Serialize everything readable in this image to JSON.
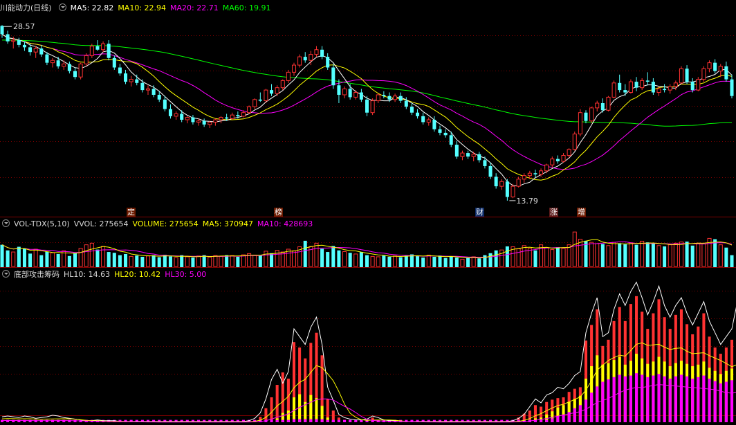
{
  "price_panel": {
    "stock_name": "川能动力",
    "period": "(日线)",
    "ma5_label": "MA5: 22.82",
    "ma10_label": "MA10: 22.94",
    "ma20_label": "MA20: 22.71",
    "ma60_label": "MA60: 19.91",
    "high_marker": "28.57",
    "low_marker": "13.79"
  },
  "event_tags": [
    "定",
    "榜",
    "财",
    "涨",
    "增"
  ],
  "volume_panel": {
    "name": "VOL-TDX(5,10)",
    "vvol_label": "VVOL: 275654",
    "volume_label": "VOLUME: 275654",
    "ma5_label": "MA5: 370947",
    "ma10_label": "MA10: 428693"
  },
  "indicator_panel": {
    "name": "底部攻击筹码",
    "hl10_label": "HL10: 14.63",
    "hl20_label": "HL20: 10.42",
    "hl30_label": "HL30: 5.00"
  },
  "colors": {
    "up": "#ff3232",
    "down": "#54ffff",
    "ma5": "#ffffff",
    "ma10": "#ffff00",
    "ma20": "#ff00ff",
    "ma60": "#00ff00",
    "grid": "#800000"
  },
  "chart_data": {
    "type": "candlestick",
    "price_markers": {
      "high": 28.57,
      "low": 13.79
    },
    "moving_average_values": {
      "MA5": 22.82,
      "MA10": 22.94,
      "MA20": 22.71,
      "MA60": 19.91
    },
    "volume_indicator_values": {
      "VVOL": 275654,
      "VOLUME": 275654,
      "MA5": 370947,
      "MA10": 428693
    },
    "bottom_indicator_values": {
      "HL10": 14.63,
      "HL20": 10.42,
      "HL30": 5.0
    },
    "ohlc": [
      [
        28.5,
        28.57,
        27.5,
        27.8
      ],
      [
        27.8,
        28.1,
        27.0,
        27.2
      ],
      [
        27.2,
        27.6,
        26.6,
        27.3
      ],
      [
        27.3,
        27.5,
        26.7,
        26.9
      ],
      [
        26.9,
        27.2,
        26.4,
        26.7
      ],
      [
        26.7,
        27.0,
        26.0,
        26.3
      ],
      [
        26.3,
        26.8,
        25.8,
        26.6
      ],
      [
        26.6,
        26.9,
        25.9,
        26.1
      ],
      [
        26.1,
        26.3,
        25.2,
        25.4
      ],
      [
        25.4,
        25.8,
        25.0,
        25.6
      ],
      [
        25.6,
        25.9,
        24.9,
        25.1
      ],
      [
        25.1,
        25.6,
        24.8,
        25.3
      ],
      [
        25.3,
        25.5,
        24.5,
        24.7
      ],
      [
        24.7,
        25.0,
        24.0,
        24.2
      ],
      [
        24.2,
        25.4,
        24.0,
        25.3
      ],
      [
        25.3,
        26.2,
        25.1,
        26.0
      ],
      [
        26.0,
        27.0,
        25.8,
        26.8
      ],
      [
        26.8,
        27.3,
        26.4,
        26.5
      ],
      [
        26.5,
        27.2,
        26.3,
        27.0
      ],
      [
        27.0,
        27.3,
        25.6,
        25.8
      ],
      [
        25.8,
        26.0,
        24.8,
        25.0
      ],
      [
        25.0,
        25.3,
        24.3,
        24.5
      ],
      [
        24.5,
        24.8,
        23.6,
        23.8
      ],
      [
        23.8,
        24.3,
        23.4,
        24.0
      ],
      [
        24.0,
        24.4,
        23.5,
        23.7
      ],
      [
        23.7,
        24.0,
        22.9,
        23.1
      ],
      [
        23.1,
        23.5,
        22.7,
        23.2
      ],
      [
        23.2,
        23.5,
        22.5,
        22.7
      ],
      [
        22.7,
        23.0,
        22.1,
        22.3
      ],
      [
        22.3,
        22.6,
        21.3,
        21.5
      ],
      [
        21.5,
        21.9,
        20.7,
        20.9
      ],
      [
        20.9,
        21.3,
        20.6,
        21.1
      ],
      [
        21.1,
        21.4,
        20.4,
        20.6
      ],
      [
        20.6,
        20.9,
        20.3,
        20.8
      ],
      [
        20.8,
        21.0,
        20.2,
        20.4
      ],
      [
        20.4,
        20.7,
        20.1,
        20.5
      ],
      [
        20.5,
        20.7,
        20.0,
        20.2
      ],
      [
        20.2,
        20.5,
        19.9,
        20.4
      ],
      [
        20.4,
        20.7,
        20.1,
        20.6
      ],
      [
        20.6,
        20.9,
        20.3,
        20.8
      ],
      [
        20.8,
        21.1,
        20.5,
        20.7
      ],
      [
        20.7,
        21.2,
        20.6,
        21.0
      ],
      [
        21.0,
        21.3,
        20.7,
        20.9
      ],
      [
        20.9,
        21.4,
        20.8,
        21.2
      ],
      [
        21.2,
        21.8,
        21.1,
        21.7
      ],
      [
        21.7,
        22.4,
        21.5,
        22.3
      ],
      [
        22.3,
        22.9,
        22.1,
        22.2
      ],
      [
        22.2,
        23.2,
        22.0,
        23.1
      ],
      [
        23.1,
        23.6,
        22.6,
        22.8
      ],
      [
        22.8,
        23.5,
        22.6,
        23.3
      ],
      [
        23.3,
        24.0,
        23.1,
        23.9
      ],
      [
        23.9,
        24.8,
        23.7,
        24.6
      ],
      [
        24.6,
        25.4,
        24.3,
        25.2
      ],
      [
        25.2,
        26.1,
        25.0,
        25.9
      ],
      [
        25.9,
        26.3,
        25.4,
        25.6
      ],
      [
        25.6,
        26.4,
        25.2,
        26.1
      ],
      [
        26.1,
        26.8,
        25.9,
        26.5
      ],
      [
        26.5,
        26.8,
        25.7,
        25.9
      ],
      [
        25.9,
        26.2,
        24.8,
        25.0
      ],
      [
        25.0,
        25.3,
        23.2,
        23.5
      ],
      [
        23.5,
        24.0,
        22.0,
        22.7
      ],
      [
        22.7,
        23.4,
        22.4,
        23.2
      ],
      [
        23.2,
        23.6,
        22.3,
        22.5
      ],
      [
        22.5,
        23.1,
        22.3,
        22.9
      ],
      [
        22.9,
        23.2,
        22.1,
        22.3
      ],
      [
        22.3,
        22.6,
        20.9,
        21.2
      ],
      [
        21.2,
        22.4,
        21.0,
        22.2
      ],
      [
        22.2,
        22.8,
        22.0,
        22.7
      ],
      [
        22.7,
        23.0,
        22.4,
        22.6
      ],
      [
        22.6,
        22.9,
        22.1,
        22.3
      ],
      [
        22.3,
        22.8,
        22.1,
        22.6
      ],
      [
        22.6,
        22.9,
        22.0,
        22.2
      ],
      [
        22.2,
        22.5,
        21.5,
        21.7
      ],
      [
        21.7,
        22.0,
        21.0,
        21.2
      ],
      [
        21.2,
        21.5,
        20.7,
        20.9
      ],
      [
        20.9,
        21.2,
        20.2,
        20.4
      ],
      [
        20.4,
        20.8,
        20.1,
        20.6
      ],
      [
        20.6,
        20.9,
        19.6,
        19.8
      ],
      [
        19.8,
        20.1,
        19.3,
        19.5
      ],
      [
        19.5,
        19.8,
        19.1,
        19.3
      ],
      [
        19.3,
        19.6,
        18.3,
        18.5
      ],
      [
        18.5,
        18.8,
        17.3,
        17.5
      ],
      [
        17.5,
        18.0,
        17.2,
        17.8
      ],
      [
        17.8,
        18.0,
        17.3,
        17.5
      ],
      [
        17.5,
        17.9,
        17.1,
        17.7
      ],
      [
        17.7,
        17.9,
        17.0,
        17.2
      ],
      [
        17.2,
        17.5,
        16.5,
        16.7
      ],
      [
        16.7,
        17.0,
        15.6,
        15.8
      ],
      [
        15.8,
        16.1,
        14.8,
        15.0
      ],
      [
        15.0,
        15.6,
        14.7,
        15.4
      ],
      [
        15.4,
        15.6,
        13.79,
        14.1
      ],
      [
        14.1,
        15.2,
        14.0,
        15.0
      ],
      [
        15.0,
        15.8,
        14.9,
        15.6
      ],
      [
        15.6,
        16.1,
        15.3,
        15.9
      ],
      [
        15.9,
        16.3,
        15.6,
        16.1
      ],
      [
        16.1,
        16.4,
        15.7,
        16.0
      ],
      [
        16.0,
        16.5,
        15.8,
        16.3
      ],
      [
        16.3,
        16.9,
        16.1,
        16.8
      ],
      [
        16.8,
        17.5,
        16.6,
        17.3
      ],
      [
        17.3,
        17.6,
        16.9,
        17.1
      ],
      [
        17.1,
        17.8,
        17.0,
        17.6
      ],
      [
        17.6,
        18.2,
        17.4,
        18.1
      ],
      [
        18.1,
        19.6,
        18.0,
        19.4
      ],
      [
        19.4,
        21.5,
        19.2,
        21.2
      ],
      [
        21.2,
        21.4,
        20.3,
        20.5
      ],
      [
        20.5,
        21.7,
        20.3,
        21.6
      ],
      [
        21.6,
        22.2,
        21.3,
        22.0
      ],
      [
        22.0,
        22.4,
        21.2,
        21.4
      ],
      [
        21.4,
        22.6,
        21.3,
        22.5
      ],
      [
        22.5,
        23.9,
        22.4,
        23.7
      ],
      [
        23.7,
        24.4,
        22.9,
        23.1
      ],
      [
        23.1,
        23.6,
        22.6,
        22.9
      ],
      [
        22.9,
        24.0,
        22.8,
        23.8
      ],
      [
        23.8,
        24.2,
        23.0,
        23.3
      ],
      [
        23.3,
        24.1,
        23.1,
        23.9
      ],
      [
        23.9,
        24.6,
        23.5,
        23.8
      ],
      [
        23.8,
        24.1,
        22.7,
        22.9
      ],
      [
        22.9,
        23.4,
        22.6,
        23.2
      ],
      [
        23.2,
        23.6,
        22.9,
        23.1
      ],
      [
        23.1,
        23.6,
        22.8,
        23.4
      ],
      [
        23.4,
        23.9,
        23.1,
        23.7
      ],
      [
        23.7,
        25.1,
        23.6,
        24.9
      ],
      [
        24.9,
        25.2,
        23.6,
        23.8
      ],
      [
        23.8,
        24.1,
        22.9,
        23.1
      ],
      [
        23.1,
        24.2,
        23.0,
        24.0
      ],
      [
        24.0,
        25.1,
        23.8,
        24.9
      ],
      [
        24.9,
        25.6,
        24.6,
        25.4
      ],
      [
        25.4,
        25.7,
        24.5,
        24.7
      ],
      [
        24.7,
        25.3,
        24.2,
        25.1
      ],
      [
        25.1,
        25.5,
        23.8,
        24.0
      ],
      [
        24.0,
        24.4,
        22.4,
        22.6
      ]
    ],
    "volume": [
      560,
      420,
      380,
      510,
      470,
      340,
      450,
      300,
      390,
      360,
      330,
      410,
      280,
      350,
      470,
      560,
      600,
      440,
      520,
      380,
      360,
      300,
      330,
      270,
      290,
      260,
      280,
      300,
      250,
      310,
      270,
      240,
      300,
      260,
      240,
      280,
      300,
      250,
      290,
      270,
      300,
      290,
      260,
      310,
      340,
      300,
      290,
      400,
      350,
      420,
      380,
      450,
      410,
      510,
      660,
      520,
      600,
      460,
      380,
      530,
      420,
      390,
      360,
      330,
      380,
      300,
      270,
      260,
      290,
      260,
      280,
      250,
      300,
      320,
      280,
      240,
      300,
      260,
      290,
      230,
      270,
      240,
      200,
      230,
      260,
      220,
      300,
      350,
      420,
      430,
      520,
      510,
      460,
      540,
      470,
      420,
      560,
      490,
      440,
      500,
      470,
      560,
      880,
      700,
      660,
      620,
      590,
      580,
      540,
      620,
      600,
      570,
      610,
      560,
      650,
      620,
      590,
      540,
      520,
      560,
      600,
      630,
      640,
      540,
      600,
      580,
      720,
      700,
      560,
      490,
      300
    ],
    "indicator": {
      "white_line": [
        0.7,
        0.8,
        0.7,
        0.6,
        0.8,
        0.7,
        0.5,
        0.6,
        0.7,
        0.9,
        0.8,
        0.6,
        0.5,
        0.4,
        0.3,
        0.2,
        0.2,
        0.3,
        0.2,
        0.2,
        0.2,
        0.1,
        0.1,
        0.1,
        0.1,
        0.1,
        0.1,
        0.1,
        0.1,
        0.1,
        0.1,
        0.1,
        0.1,
        0.1,
        0.1,
        0.1,
        0.1,
        0.1,
        0.1,
        0.1,
        0.1,
        0.1,
        0.1,
        0.1,
        0.2,
        0.5,
        1.2,
        3.0,
        5.5,
        6.8,
        5.0,
        6.5,
        12.0,
        11.0,
        10.0,
        12.2,
        13.5,
        10.0,
        4.5,
        2.8,
        1.0,
        0.6,
        0.4,
        0.3,
        0.3,
        0.4,
        0.8,
        0.6,
        0.3,
        0.2,
        0.2,
        0.1,
        0.1,
        0.1,
        0.1,
        0.1,
        0.1,
        0.1,
        0.1,
        0.1,
        0.1,
        0.1,
        0.1,
        0.1,
        0.1,
        0.1,
        0.1,
        0.1,
        0.1,
        0.1,
        0.1,
        0.2,
        0.5,
        1.0,
        2.0,
        3.0,
        2.5,
        3.5,
        3.8,
        4.5,
        4.3,
        5.0,
        6.0,
        6.5,
        11.5,
        14.0,
        16.0,
        11.0,
        11.5,
        14.5,
        16.5,
        15.0,
        16.8,
        18.0,
        16.0,
        13.8,
        15.5,
        17.5,
        15.0,
        13.5,
        15.0,
        16.0,
        14.0,
        12.5,
        14.0,
        15.5,
        13.0,
        11.5,
        10.0,
        11.0,
        12.0,
        15.5,
        18.0,
        12.0,
        8.0,
        6.0,
        4.0
      ],
      "red_bars": [
        0,
        0,
        0,
        0,
        0,
        0,
        0,
        0,
        0,
        0,
        0,
        0,
        0,
        0,
        0,
        0.2,
        0,
        0.3,
        0,
        0,
        0,
        0,
        0,
        0,
        0,
        0,
        0,
        0,
        0,
        0,
        0,
        0,
        0,
        0,
        0,
        0,
        0,
        0,
        0,
        0,
        0,
        0,
        0,
        0,
        0,
        0,
        0.7,
        1.8,
        3.2,
        4.8,
        6.4,
        5.6,
        10.3,
        9.6,
        8.2,
        10.2,
        11.5,
        8.6,
        3.0,
        1.5,
        0.6,
        0.3,
        0.2,
        0.2,
        0.2,
        0.3,
        0.6,
        0.3,
        0.2,
        0,
        0,
        0,
        0,
        0,
        0,
        0,
        0,
        0,
        0,
        0,
        0,
        0,
        0,
        0,
        0,
        0,
        0,
        0,
        0,
        0,
        0,
        0.3,
        0.6,
        1.1,
        1.5,
        2.2,
        2.0,
        2.6,
        2.9,
        3.1,
        3.2,
        3.9,
        4.3,
        4.5,
        10.5,
        12.5,
        14.5,
        9.8,
        10.6,
        13.0,
        14.8,
        13.0,
        15.2,
        16.2,
        14.2,
        12.0,
        14.0,
        15.8,
        13.5,
        12.0,
        13.8,
        14.5,
        12.6,
        11.3,
        12.3,
        14.0,
        11.0,
        9.6,
        8.8,
        9.6,
        10.6,
        14.2,
        16.5,
        10.8,
        6.8,
        5.2,
        3.5
      ],
      "yellow_bars": [
        0,
        0,
        0,
        0,
        0,
        0,
        0,
        0,
        0,
        0,
        0,
        0,
        0,
        0,
        0,
        0,
        0,
        0,
        0,
        0,
        0,
        0,
        0,
        0,
        0,
        0,
        0,
        0,
        0,
        0,
        0,
        0,
        0,
        0,
        0,
        0,
        0,
        0,
        0,
        0,
        0,
        0,
        0,
        0,
        0,
        0,
        0,
        0,
        0,
        0.5,
        1.2,
        1.5,
        3.2,
        3.6,
        2.6,
        3.5,
        3.1,
        2.1,
        0.6,
        0.2,
        0,
        0,
        0,
        0,
        0,
        0,
        0,
        0,
        0,
        0,
        0,
        0,
        0,
        0,
        0,
        0,
        0,
        0,
        0,
        0,
        0,
        0,
        0,
        0,
        0,
        0,
        0,
        0,
        0,
        0,
        0,
        0,
        0,
        0,
        0.2,
        0.5,
        0.6,
        1.0,
        1.4,
        1.9,
        2.2,
        2.6,
        3.0,
        3.4,
        5.6,
        7.2,
        8.6,
        7.4,
        7.6,
        8.0,
        8.4,
        7.4,
        7.9,
        8.8,
        8.2,
        7.5,
        7.8,
        8.4,
        7.8,
        7.2,
        7.6,
        7.9,
        7.5,
        7.2,
        7.4,
        7.8,
        7.0,
        6.6,
        6.2,
        6.6,
        6.9,
        7.9,
        8.2,
        7.5,
        5.8,
        4.5,
        3.0
      ],
      "magenta_bars": [
        0.3,
        0.3,
        0.3,
        0.3,
        0.3,
        0.3,
        0.3,
        0.3,
        0.3,
        0.3,
        0.3,
        0.3,
        0.3,
        0.3,
        0.3,
        0.3,
        0.3,
        0.3,
        0.3,
        0.3,
        0.3,
        0.3,
        0.3,
        0.3,
        0.3,
        0.3,
        0.3,
        0.3,
        0.3,
        0.3,
        0.3,
        0.3,
        0.3,
        0.3,
        0.3,
        0.3,
        0.3,
        0.3,
        0.3,
        0.3,
        0.3,
        0.3,
        0.3,
        0.3,
        0.3,
        0.3,
        0.3,
        0.3,
        0.3,
        0.3,
        0.3,
        0.3,
        0.4,
        0.4,
        0.4,
        0.4,
        0.4,
        0.4,
        0.3,
        0.3,
        0.3,
        0.3,
        0.3,
        0.3,
        0.3,
        0.3,
        0.3,
        0.3,
        0.3,
        0.3,
        0.3,
        0.3,
        0.3,
        0.3,
        0.3,
        0.3,
        0.3,
        0.3,
        0.3,
        0.3,
        0.3,
        0.3,
        0.3,
        0.3,
        0.3,
        0.3,
        0.3,
        0.3,
        0.3,
        0.3,
        0.3,
        0.3,
        0.3,
        0.3,
        0.3,
        0.3,
        0.3,
        0.3,
        0.5,
        0.8,
        1.0,
        1.3,
        1.8,
        2.2,
        2.9,
        3.8,
        4.6,
        5.2,
        5.5,
        5.8,
        6.1,
        5.9,
        6.0,
        6.3,
        6.1,
        5.8,
        6.0,
        6.2,
        5.9,
        5.6,
        5.9,
        6.1,
        5.9,
        5.6,
        5.8,
        6.0,
        5.6,
        5.3,
        5.0,
        5.2,
        5.4,
        5.8,
        6.0,
        5.6,
        4.8,
        4.0,
        2.6
      ]
    },
    "event_tag_index": [
      25,
      53,
      91,
      107,
      114
    ]
  }
}
